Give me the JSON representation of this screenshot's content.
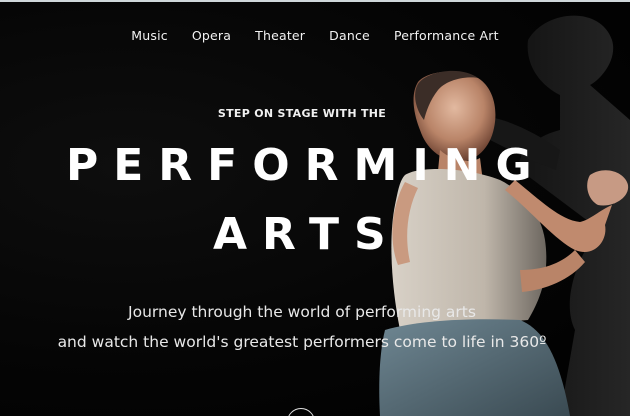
{
  "nav": {
    "items": [
      {
        "label": "Music"
      },
      {
        "label": "Opera"
      },
      {
        "label": "Theater"
      },
      {
        "label": "Dance"
      },
      {
        "label": "Performance Art"
      }
    ]
  },
  "hero": {
    "kicker": "STEP ON STAGE WITH THE",
    "title_line1": "PERFORMING",
    "title_line2": "ARTS",
    "subtitle_line1": "Journey through the world of performing arts",
    "subtitle_line2": "and watch the world's greatest performers come to life in 360º"
  },
  "icons": {
    "scroll": "chevron-down-icon"
  },
  "colors": {
    "background": "#000000",
    "text": "#ffffff"
  }
}
